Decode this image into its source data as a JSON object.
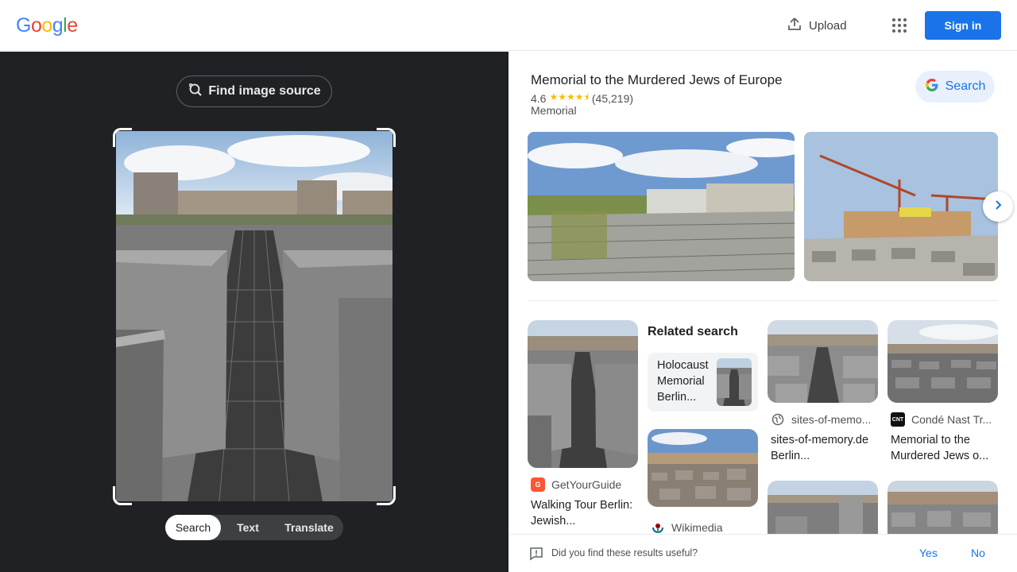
{
  "header": {
    "logo_letters": [
      {
        "ch": "G",
        "color": "#4285f4"
      },
      {
        "ch": "o",
        "color": "#ea4335"
      },
      {
        "ch": "o",
        "color": "#fbbc05"
      },
      {
        "ch": "g",
        "color": "#4285f4"
      },
      {
        "ch": "l",
        "color": "#34a853"
      },
      {
        "ch": "e",
        "color": "#ea4335"
      }
    ],
    "upload_label": "Upload",
    "apps_icon": "apps-grid-icon",
    "signin_label": "Sign in",
    "accent": "#1a73e8"
  },
  "lens": {
    "find_source_label": "Find image source",
    "tabs": [
      {
        "label": "Search",
        "active": true
      },
      {
        "label": "Text",
        "active": false
      },
      {
        "label": "Translate",
        "active": false
      }
    ]
  },
  "knowledge_panel": {
    "title": "Memorial to the Murdered Jews of Europe",
    "rating": "4.6",
    "stars": "★★★★⯨",
    "reviews": "(45,219)",
    "type": "Memorial",
    "search_label": "Search"
  },
  "related": {
    "label": "Related search",
    "card_label": "Holocaust Memorial Berlin..."
  },
  "results": [
    {
      "source": "GetYourGuide",
      "title": "Walking Tour Berlin: Jewish..."
    },
    {
      "source": "Wikimedia",
      "title": ""
    },
    {
      "source": "sites-of-memo...",
      "title": "sites-of-memory.de Berlin..."
    },
    {
      "source": "Condé Nast Tr...",
      "title": "Memorial to the Murdered Jews o..."
    }
  ],
  "feedback": {
    "question": "Did you find these results useful?",
    "yes": "Yes",
    "no": "No"
  }
}
